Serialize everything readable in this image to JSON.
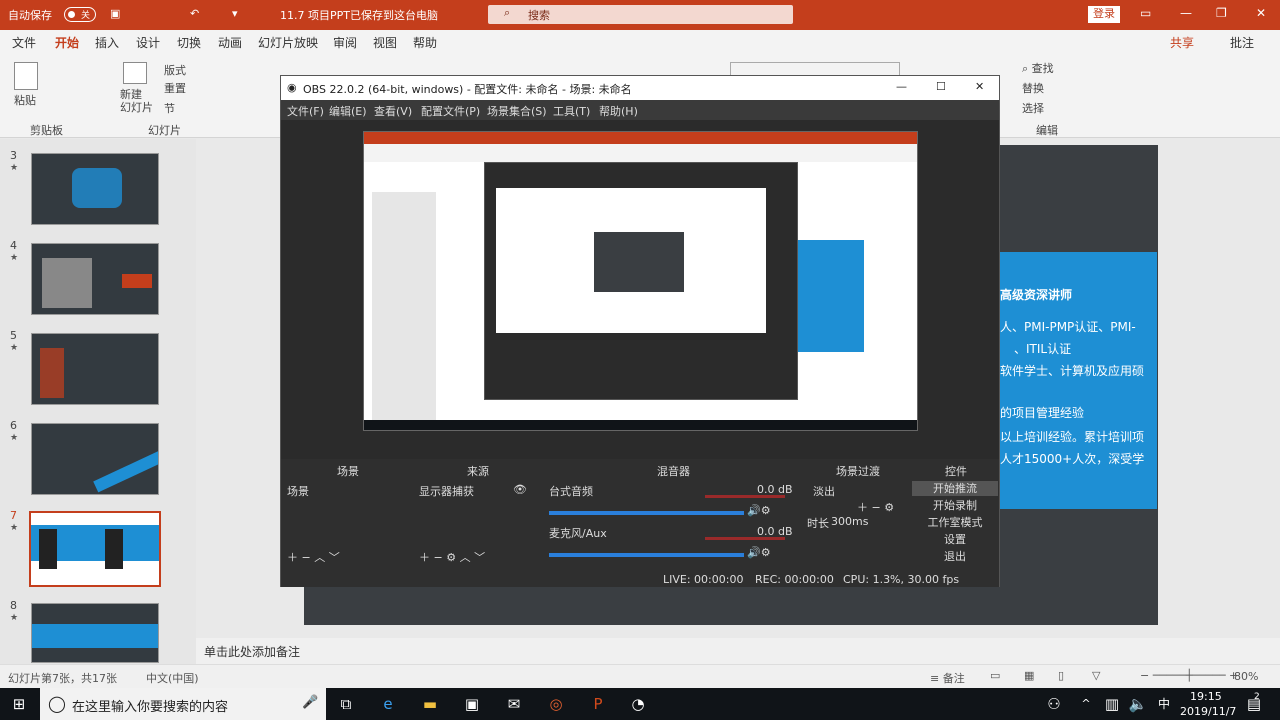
{
  "powerpoint": {
    "titlebar": {
      "autosave": "自动保存",
      "toggle": "关",
      "doc_title": "已保存到这台电脑",
      "doc_name": "11.7 项目PPT",
      "search_placeholder": "搜索",
      "login": "登录",
      "share": "共享",
      "comments": "批注"
    },
    "tabs": [
      "文件",
      "开始",
      "插入",
      "设计",
      "切换",
      "动画",
      "幻灯片放映",
      "审阅",
      "视图",
      "帮助"
    ],
    "ribbon": {
      "paste": "粘贴",
      "clipboard": "剪贴板",
      "new_slide": "新建\n幻灯片",
      "layout": "版式",
      "reset": "重置",
      "section": "节",
      "slides_group": "幻灯片",
      "find": "查找",
      "replace": "替换",
      "select": "选择",
      "editing": "编辑"
    },
    "slides": [
      {
        "num": "3"
      },
      {
        "num": "4"
      },
      {
        "num": "5"
      },
      {
        "num": "6"
      },
      {
        "num": "7"
      },
      {
        "num": "8"
      }
    ],
    "slide_text": {
      "l1": "高级资深讲师",
      "l2": "人、PMI-PMP认证、PMI-",
      "l3": "、ITIL认证",
      "l4": "软件学士、计算机及应用硕",
      "l5": "的项目管理经验",
      "l6": "以上培训经验。累计培训项",
      "l7": "人才15000+人次，深受学"
    },
    "notes_placeholder": "单击此处添加备注",
    "statusbar": {
      "slide_info": "幻灯片第7张，共17张",
      "language": "中文(中国)",
      "notes": "备注",
      "zoom": "80%"
    }
  },
  "obs": {
    "title": "OBS 22.0.2 (64-bit, windows) - 配置文件: 未命名 - 场景: 未命名",
    "menu": [
      "文件(F)",
      "编辑(E)",
      "查看(V)",
      "配置文件(P)",
      "场景集合(S)",
      "工具(T)",
      "帮助(H)"
    ],
    "docks": {
      "scenes_header": "场景",
      "sources_header": "来源",
      "mixer_header": "混音器",
      "transitions_header": "场景过渡",
      "controls_header": "控件",
      "scene_item": "场景",
      "source_item": "显示器捕获",
      "mixer_ch1": "台式音频",
      "mixer_ch1_db": "0.0 dB",
      "mixer_ch2": "麦克风/Aux",
      "mixer_ch2_db": "0.0 dB",
      "transition": "淡出",
      "duration_label": "时长",
      "duration": "300ms",
      "ctrl_stream": "开始推流",
      "ctrl_record": "开始录制",
      "ctrl_studio": "工作室模式",
      "ctrl_settings": "设置",
      "ctrl_exit": "退出"
    },
    "statusbar": {
      "live": "LIVE: 00:00:00",
      "rec": "REC: 00:00:00",
      "cpu": "CPU: 1.3%, 30.00 fps"
    }
  },
  "taskbar": {
    "search_placeholder": "在这里输入你要搜索的内容",
    "time": "19:15",
    "date": "2019/11/7",
    "notifications": "2"
  },
  "colors": {
    "pp_accent": "#c43e1c",
    "slide_blue": "#1e8fd4",
    "obs_bg": "#2b2b2b",
    "meter_blue": "#2a7fdb"
  }
}
